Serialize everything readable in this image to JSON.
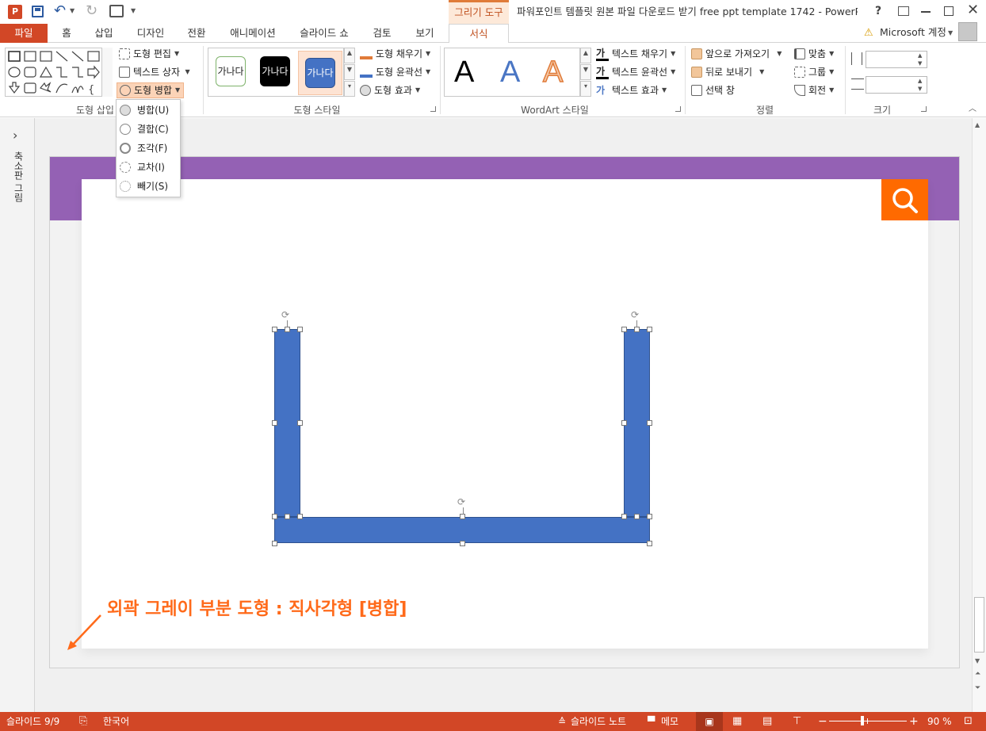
{
  "window": {
    "title": "파워포인트 템플릿 원본 파일 다운로드 받기 free ppt template 1742 - PowerP...",
    "contextual_tab_group": "그리기 도구",
    "help_label": "?"
  },
  "tabs": [
    {
      "label": "파일"
    },
    {
      "label": "홈"
    },
    {
      "label": "삽입"
    },
    {
      "label": "디자인"
    },
    {
      "label": "전환"
    },
    {
      "label": "애니메이션"
    },
    {
      "label": "슬라이드 쇼"
    },
    {
      "label": "검토"
    },
    {
      "label": "보기"
    },
    {
      "label": "서식"
    }
  ],
  "account": {
    "label": "Microsoft 계정"
  },
  "ribbon": {
    "insert_shapes": {
      "group_label": "도형 삽입",
      "edit_shape": "도형 편집",
      "text_box": "텍스트 상자",
      "merge_shapes": "도형 병합"
    },
    "shape_styles": {
      "group_label": "도형 스타일",
      "style_samples": [
        "가나다",
        "가나다",
        "가나다"
      ],
      "fill": "도형 채우기",
      "outline": "도형 윤곽선",
      "effects": "도형 효과"
    },
    "wordart": {
      "group_label": "WordArt 스타일",
      "samples": [
        "A",
        "A",
        "A"
      ],
      "text_fill": "텍스트 채우기",
      "text_outline": "텍스트 윤곽선",
      "text_effects": "텍스트 효과",
      "fill_glyph": "가",
      "outline_glyph": "가",
      "effects_glyph": "가"
    },
    "arrange": {
      "group_label": "정렬",
      "bring_forward": "앞으로 가져오기",
      "send_backward": "뒤로 보내기",
      "selection_pane": "선택 창",
      "align": "맞춤",
      "group": "그룹",
      "rotate": "회전"
    },
    "size": {
      "group_label": "크기"
    }
  },
  "merge_menu": {
    "items": [
      {
        "label": "병합(U)"
      },
      {
        "label": "결합(C)"
      },
      {
        "label": "조각(F)"
      },
      {
        "label": "교차(I)"
      },
      {
        "label": "빼기(S)"
      }
    ]
  },
  "thumbnail_pane": {
    "label": "축소판 그림",
    "expand_glyph": "›"
  },
  "slide": {
    "annotation": "외곽 그레이 부분 도형 : 직사각형 [병합]"
  },
  "statusbar": {
    "slide_counter": "슬라이드 9/9",
    "language": "한국어",
    "notes": "슬라이드 노트",
    "comments": "메모",
    "zoom": "90 %",
    "zoom_minus": "−",
    "zoom_plus": "+"
  },
  "colors": {
    "accent": "#d24726",
    "slide_header": "#9461b4",
    "shape_fill": "#4472c4",
    "search_box": "#ff6a00",
    "annotation": "#ff6a1a"
  },
  "icons": [
    "powerpoint-app-icon",
    "save-icon",
    "undo-icon",
    "redo-icon",
    "present-icon",
    "search-icon"
  ]
}
